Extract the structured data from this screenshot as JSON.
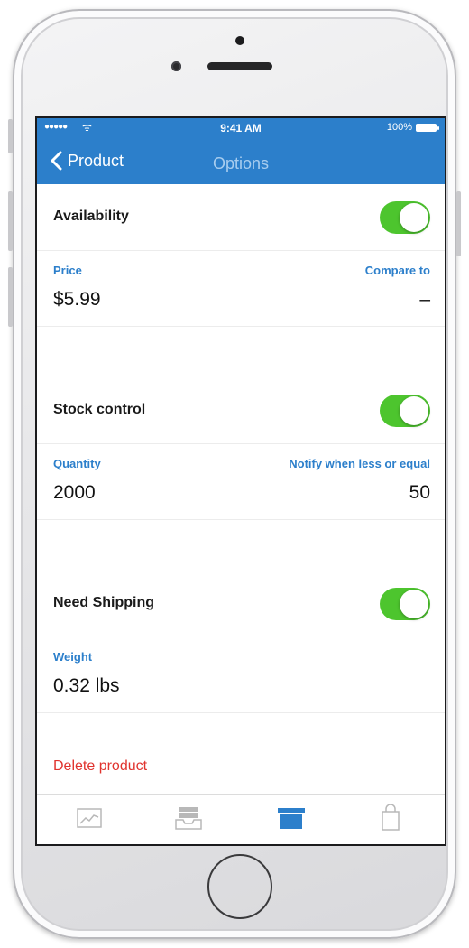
{
  "status_bar": {
    "signal": "●●●●●",
    "wifi": "ᯤ",
    "time": "9:41 AM",
    "battery": "100%"
  },
  "nav": {
    "back_label": "Product",
    "title": "Options"
  },
  "availability": {
    "label": "Availability",
    "enabled": true
  },
  "pricing": {
    "price_label": "Price",
    "price_value": "$5.99",
    "compare_label": "Compare to",
    "compare_value": "–"
  },
  "stock": {
    "label": "Stock control",
    "enabled": true,
    "quantity_label": "Quantity",
    "quantity_value": "2000",
    "notify_label": "Notify when less or equal",
    "notify_value": "50"
  },
  "shipping": {
    "label": "Need Shipping",
    "enabled": true,
    "weight_label": "Weight",
    "weight_value": "0.32 lbs"
  },
  "delete_label": "Delete product",
  "tabbar": {
    "items": [
      {
        "icon": "stats-chart-icon",
        "active": false
      },
      {
        "icon": "orders-tray-icon",
        "active": false
      },
      {
        "icon": "products-box-icon",
        "active": true
      },
      {
        "icon": "store-bag-icon",
        "active": false
      }
    ]
  },
  "colors": {
    "accent": "#2c7fcb",
    "toggle_on": "#4dc52e",
    "danger": "#e0332e",
    "nav_title": "#a8cdef",
    "tab_inactive": "#b8b8b8"
  }
}
